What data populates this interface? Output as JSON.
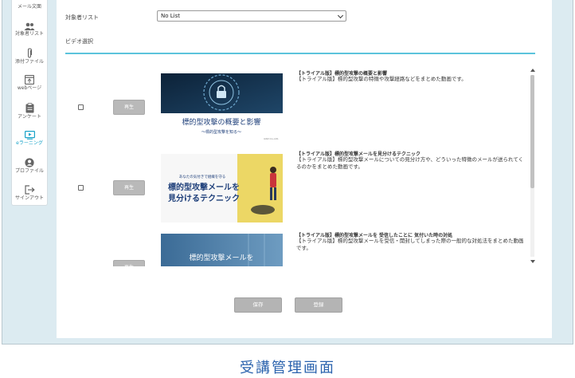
{
  "sidebar": {
    "items": [
      {
        "label": "メール文面",
        "icon": "mail-icon"
      },
      {
        "label": "対象者リスト",
        "icon": "users-icon"
      },
      {
        "label": "添付ファイル",
        "icon": "paperclip-icon"
      },
      {
        "label": "webページ",
        "icon": "webpage-icon"
      },
      {
        "label": "アンケート",
        "icon": "clipboard-icon"
      },
      {
        "label": "eラーニング",
        "icon": "video-play-icon",
        "active": true
      },
      {
        "label": "プロファイル",
        "icon": "profile-icon"
      },
      {
        "label": "サインアウト",
        "icon": "sign-out-icon"
      }
    ]
  },
  "form": {
    "target_list_label": "対象者リスト",
    "target_list_value": "No List",
    "video_section_label": "ビデオ選択"
  },
  "videos": [
    {
      "play_label": "再生",
      "title": "【トライアル版】標的型攻撃の概要と影響",
      "description": "【トライアル版】標的型攻撃の特徴や攻撃経路などをまとめた動画です。",
      "thumb_title": "標的型攻撃の概要と影響",
      "thumb_subtitle": "〜標的型攻撃を知る〜",
      "thumb_credit": "GSX Co.,Ltd."
    },
    {
      "play_label": "再生",
      "title": "【トライアル版】標的型攻撃メールを見分けるテクニック",
      "description": "【トライアル版】標的型攻撃メールについての見分け方や、どういった特徴のメールが送られてくるのかをまとめた動画です。",
      "thumb_title_small": "あなたの気付きで組織を守る",
      "thumb_title_line1": "標的型攻撃メールを",
      "thumb_title_line2": "見分けるテクニック"
    },
    {
      "play_label": "再生",
      "title": "【トライアル版】標的型攻撃メールを 受信したことに 気付いた時の対処",
      "description": "【トライアル版】標的型攻撃メールを受信・開封してしまった際の一般的な対処法をまとめた動画です。",
      "thumb_title": "標的型攻撃メールを"
    }
  ],
  "actions": {
    "save_label": "保存",
    "register_label": "登録"
  },
  "caption": "受講管理画面",
  "colors": {
    "accent": "#1aa3c8",
    "frame_bg": "#dcebf1",
    "caption": "#2a62ad",
    "button_gray": "#b4b4b4"
  }
}
